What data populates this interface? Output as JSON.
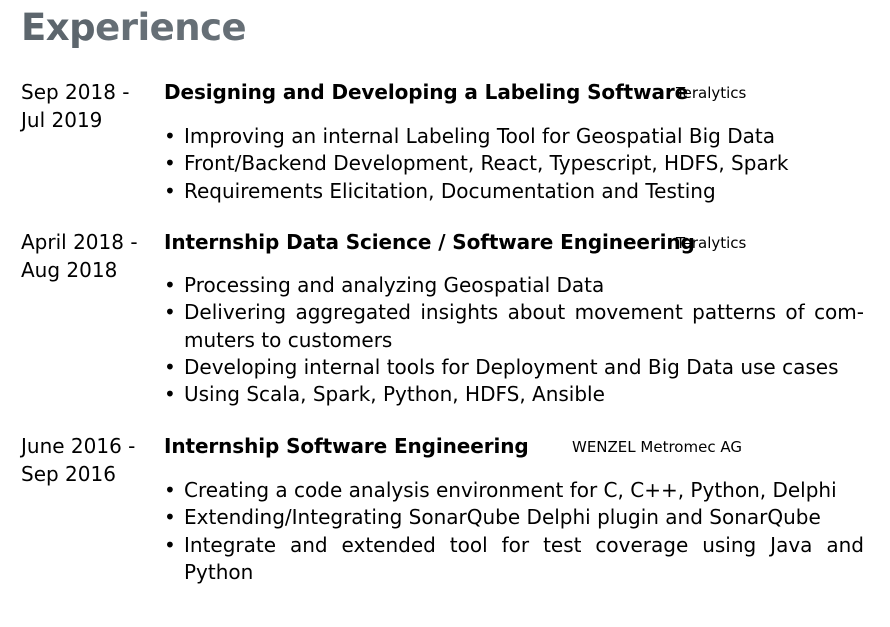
{
  "section": {
    "title_part1": "Exp",
    "title_part2": "erience"
  },
  "entries": [
    {
      "date_start": "Sep 2018 -",
      "date_end": "Jul 2019",
      "role": "Designing and Developing a Labeling Software",
      "company": "Teralytics",
      "bullets": [
        "Improving an internal Labeling Tool for Geospatial Big Data",
        "Front/Backend Development, React, Typescript, HDFS, Spark",
        "Requirements Elicitation, Documentation and Testing"
      ]
    },
    {
      "date_start": "April 2018 -",
      "date_end": "Aug 2018",
      "role": "Internship Data Science / Software Engineering",
      "company": "Teralytics",
      "bullets": [
        "Processing and analyzing Geospatial Data",
        "Delivering aggregated insights about movement patterns of com-muters to customers",
        "Developing internal tools for Deployment and Big Data use cases",
        "Using Scala, Spark, Python, HDFS, Ansible"
      ]
    },
    {
      "date_start": "June 2016 -",
      "date_end": "Sep 2016",
      "role": "Internship Software Engineering",
      "company": "WENZEL Metromec AG",
      "bullets": [
        "Creating a code analysis environment for C, C++, Python, Delphi",
        "Extending/Integrating SonarQube Delphi plugin and SonarQube",
        "Integrate and extended tool for test coverage using Java and Python"
      ]
    }
  ],
  "bullet_glyph": "•"
}
